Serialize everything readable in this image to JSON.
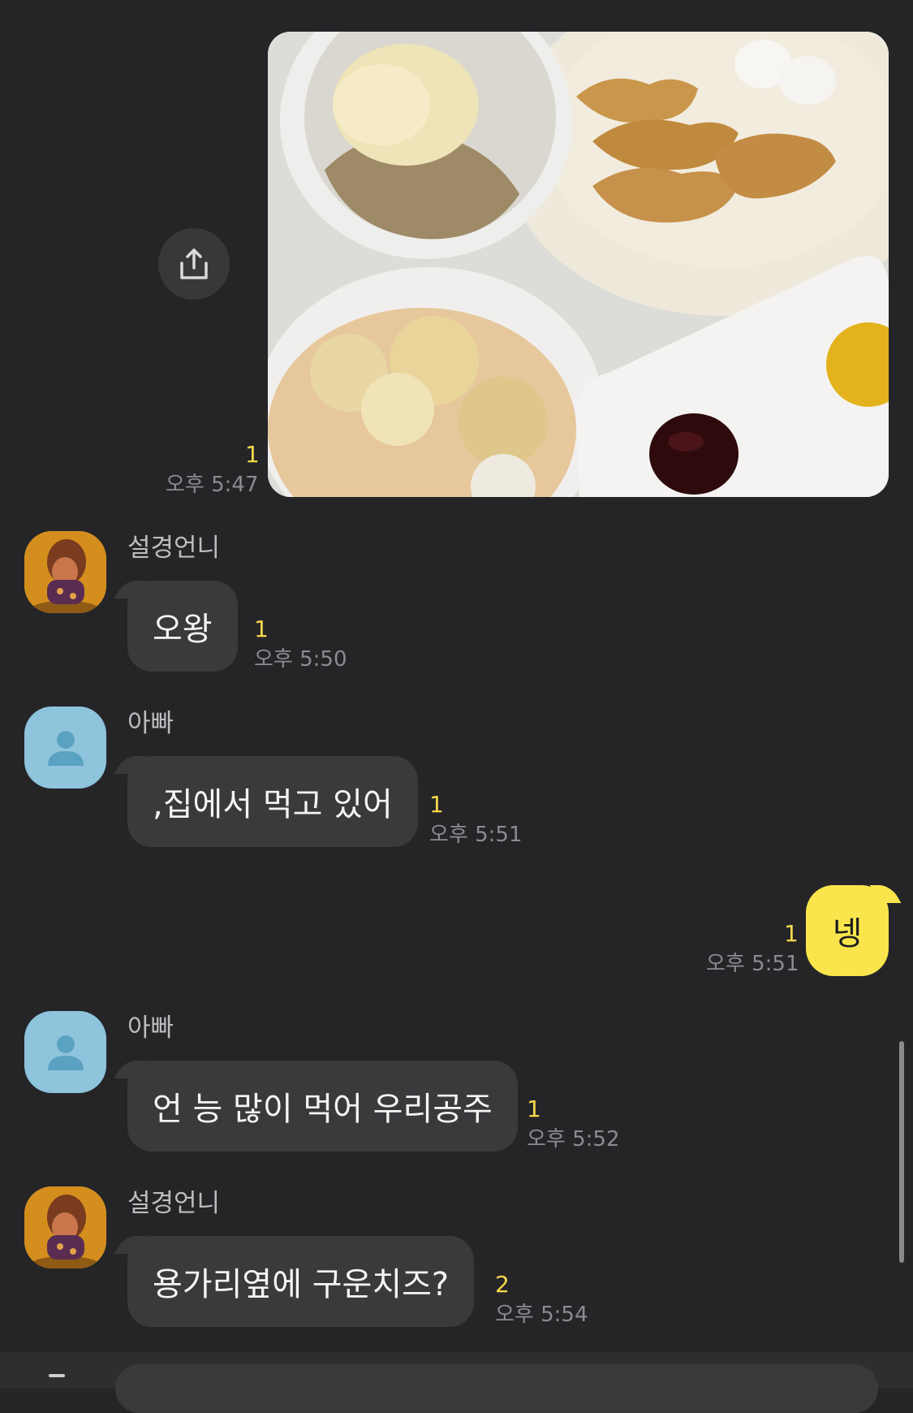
{
  "messages": {
    "photo": {
      "unread": "1",
      "time": "오후 5:47"
    },
    "m1": {
      "sender": "설경언니",
      "text": "오왕",
      "unread": "1",
      "time": "오후 5:50"
    },
    "m2": {
      "sender": "아빠",
      "text": ",집에서 먹고 있어",
      "unread": "1",
      "time": "오후 5:51"
    },
    "m3": {
      "text": "넹",
      "unread": "1",
      "time": "오후 5:51"
    },
    "m4": {
      "sender": "아빠",
      "text": "언 능 많이 먹어 우리공주",
      "unread": "1",
      "time": "오후 5:52"
    },
    "m5": {
      "sender": "설경언니",
      "text": "용가리옆에 구운치즈?",
      "unread": "2",
      "time": "오후 5:54"
    }
  },
  "icons": {
    "share": "share-icon",
    "avatar_default": "person-icon"
  },
  "colors": {
    "background": "#252528",
    "bubble_incoming": "#3a3a3d",
    "bubble_outgoing": "#fae64c",
    "unread_count": "#f7d84a",
    "timestamp": "#8c8c90"
  }
}
